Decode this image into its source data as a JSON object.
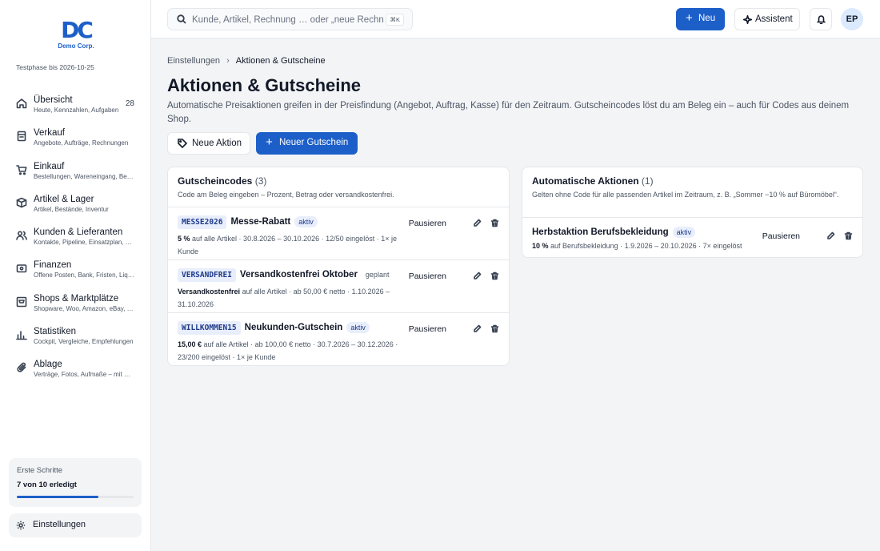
{
  "brand": {
    "logo_mark": "DC",
    "name": "Demo Corp.",
    "trial": "Testphase bis 2026-10-25"
  },
  "sidebar": {
    "items": [
      {
        "label": "Übersicht",
        "sub": "Heute, Kennzahlen, Aufgaben",
        "badge": "28",
        "icon": "home-icon"
      },
      {
        "label": "Verkauf",
        "sub": "Angebote, Aufträge, Rechnungen",
        "icon": "receipt-icon"
      },
      {
        "label": "Einkauf",
        "sub": "Bestellungen, Wareneingang, Bestand",
        "icon": "cart-icon"
      },
      {
        "label": "Artikel & Lager",
        "sub": "Artikel, Bestände, Inventur",
        "icon": "box-icon"
      },
      {
        "label": "Kunden & Lieferanten",
        "sub": "Kontakte, Pipeline, Einsatzplan, Lieferanten",
        "icon": "users-icon"
      },
      {
        "label": "Finanzen",
        "sub": "Offene Posten, Bank, Fristen, Liquidität",
        "icon": "wallet-icon"
      },
      {
        "label": "Shops & Marktplätze",
        "sub": "Shopware, Woo, Amazon, eBay, Kaufland",
        "icon": "store-icon"
      },
      {
        "label": "Statistiken",
        "sub": "Cockpit, Vergleiche, Empfehlungen",
        "icon": "bar-chart-icon"
      },
      {
        "label": "Ablage",
        "sub": "Verträge, Fotos, Aufmaße – mit Suche",
        "icon": "paperclip-icon"
      }
    ],
    "progress": {
      "title": "Erste Schritte",
      "text": "7 von 10 erledigt",
      "fraction": 0.7
    },
    "settings_label": "Einstellungen"
  },
  "topbar": {
    "search_placeholder": "Kunde, Artikel, Rechnung … oder „neue Rechnung“",
    "search_shortcut": "⌘K",
    "new_label": "Neu",
    "assistant_label": "Assistent",
    "avatar_initials": "EP"
  },
  "main": {
    "breadcrumb": [
      "Einstellungen",
      "Aktionen & Gutscheine"
    ],
    "title": "Aktionen & Gutscheine",
    "description": "Automatische Preisaktionen greifen in der Preisfindung (Angebot, Auftrag, Kasse) für den Zeitraum. Gutscheincodes löst du am Beleg ein – auch für Codes aus deinem Shop.",
    "new_action_label": "Neue Aktion",
    "new_voucher_label": "Neuer Gutschein",
    "vouchers": {
      "title": "Gutscheincodes",
      "count": "(3)",
      "subtitle": "Code am Beleg eingeben – Prozent, Betrag oder versandkostenfrei.",
      "rows": [
        {
          "code": "MESSE2026",
          "name": "Messe-Rabatt",
          "status": "aktiv",
          "value": "5 %",
          "detail": "auf alle Artikel · 30.8.2026 – 30.10.2026 · 12/50 eingelöst · 1× je Kunde",
          "pause": "Pausieren"
        },
        {
          "code": "VERSANDFREI",
          "name": "Versandkostenfrei Oktober",
          "status": "geplant",
          "value": "Versandkostenfrei",
          "detail": "auf alle Artikel · ab 50,00 € netto · 1.10.2026 – 31.10.2026",
          "pause": "Pausieren"
        },
        {
          "code": "WILLKOMMEN15",
          "name": "Neukunden-Gutschein",
          "status": "aktiv",
          "value": "15,00 €",
          "detail": "auf alle Artikel · ab 100,00 € netto · 30.7.2026 – 30.12.2026 · 23/200 eingelöst · 1× je Kunde",
          "pause": "Pausieren"
        }
      ]
    },
    "actions": {
      "title": "Automatische Aktionen",
      "count": "(1)",
      "subtitle": "Gelten ohne Code für alle passenden Artikel im Zeitraum, z. B. „Sommer −10 % auf Büromöbel“.",
      "rows": [
        {
          "name": "Herbstaktion Berufsbekleidung",
          "status": "aktiv",
          "value": "10 %",
          "detail": "auf Berufsbekleidung · 1.9.2026 – 20.10.2026 · 7× eingelöst",
          "pause": "Pausieren"
        }
      ]
    }
  },
  "colors": {
    "primary": "#1d5fc8",
    "badge_bg": "#e8eefb",
    "background": "#f3f4f6"
  }
}
